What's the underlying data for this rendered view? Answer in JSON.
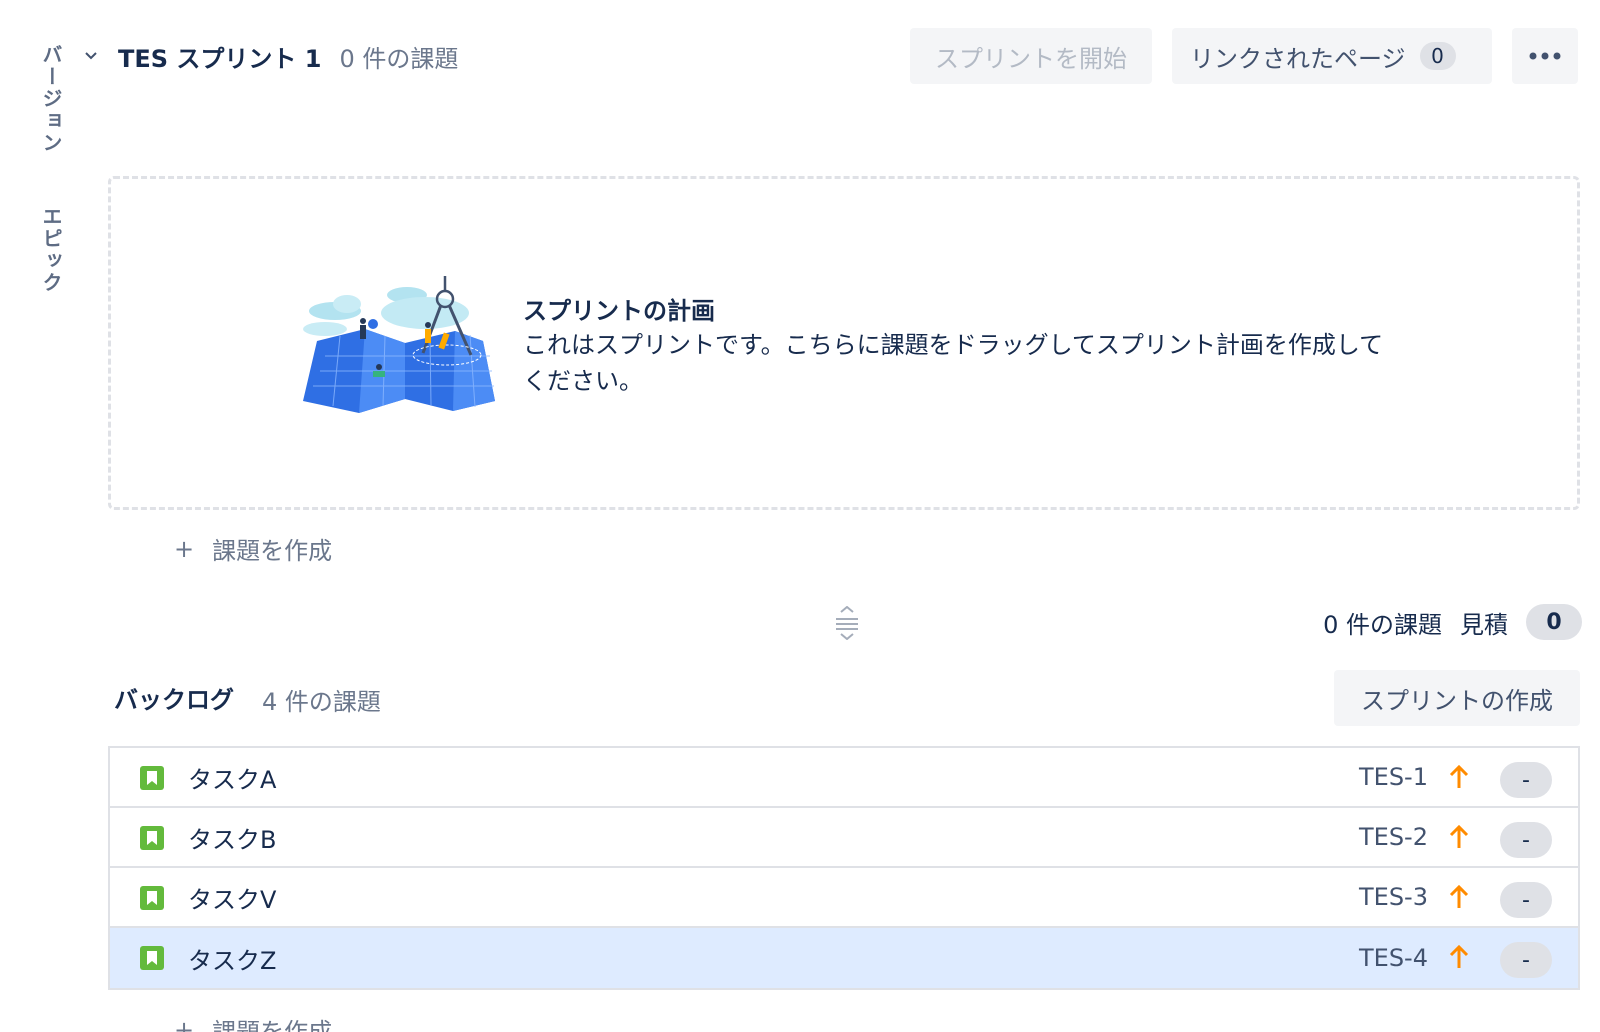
{
  "side_tabs": {
    "versions": "バージョン",
    "epics": "エピック"
  },
  "sprint": {
    "name": "TES スプリント 1",
    "issue_count": "0 件の課題",
    "start_button": "スプリントを開始",
    "linked_pages_label": "リンクされたページ",
    "linked_pages_count": "0",
    "more_icon": "more-icon",
    "empty_title": "スプリントの計画",
    "empty_description": "これはスプリントです。こちらに課題をドラッグしてスプリント計画を作成してください。",
    "create_issue": "課題を作成",
    "footer_issue_count": "0 件の課題",
    "footer_estimate_label": "見積",
    "footer_estimate_value": "0"
  },
  "backlog": {
    "title": "バックログ",
    "issue_count": "4 件の課題",
    "create_sprint_button": "スプリントの作成",
    "create_issue": "課題を作成",
    "issues": [
      {
        "summary": "タスクA",
        "key": "TES-1",
        "priority": "high",
        "estimate": "-",
        "selected": false
      },
      {
        "summary": "タスクB",
        "key": "TES-2",
        "priority": "high",
        "estimate": "-",
        "selected": false
      },
      {
        "summary": "タスクV",
        "key": "TES-3",
        "priority": "high",
        "estimate": "-",
        "selected": false
      },
      {
        "summary": "タスクZ",
        "key": "TES-4",
        "priority": "high",
        "estimate": "-",
        "selected": true
      }
    ]
  },
  "colors": {
    "story": "#63ba3c",
    "priority_high": "#ff8b00",
    "selected_row": "#deebff"
  }
}
